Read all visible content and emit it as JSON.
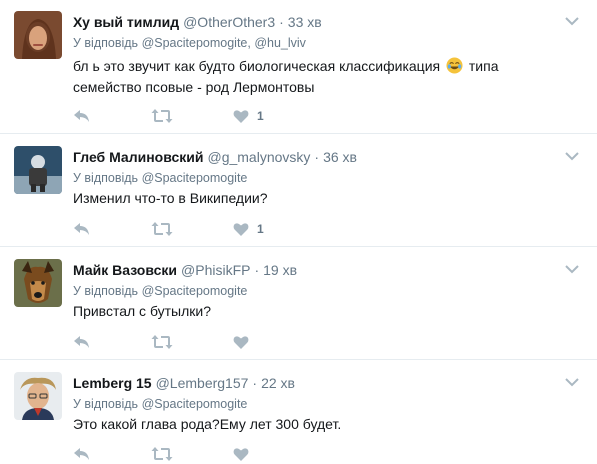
{
  "tweets": [
    {
      "name": "Ху вый тимлид",
      "handle": "@OtherOther3",
      "dot": "·",
      "time": "33 хв",
      "reply_prefix": "У відповідь",
      "reply_mentions": "@Spacitepomogite, @hu_lviv",
      "text_line1": "бл  ь это звучит как будто биологическая классификация",
      "text_line1_after": "типа",
      "text_line2": "семейство псовые - род Лермонтовы",
      "emoji": "rolling-on-floor-laughing-emoji",
      "like_count": "1"
    },
    {
      "name": "Глеб Малиновский",
      "handle": "@g_malynovsky",
      "dot": "·",
      "time": "36 хв",
      "reply_prefix": "У відповідь",
      "reply_mentions": "@Spacitepomogite",
      "text_line1": "Изменил что-то в Википедии?",
      "like_count": "1"
    },
    {
      "name": "Майк Вазовски",
      "handle": "@PhisikFP",
      "dot": "·",
      "time": "19 хв",
      "reply_prefix": "У відповідь",
      "reply_mentions": "@Spacitepomogite",
      "text_line1": "Привстал с бутылки?",
      "like_count": ""
    },
    {
      "name": "Lemberg 15",
      "handle": "@Lemberg157",
      "dot": "·",
      "time": "22 хв",
      "reply_prefix": "У відповідь",
      "reply_mentions": "@Spacitepomogite",
      "text_line1": "Это какой глава рода?Ему лет 300 будет.",
      "like_count": ""
    }
  ],
  "colors": {
    "secondary": "#657786",
    "icon": "#aab8c2",
    "border": "#e6ecf0"
  }
}
